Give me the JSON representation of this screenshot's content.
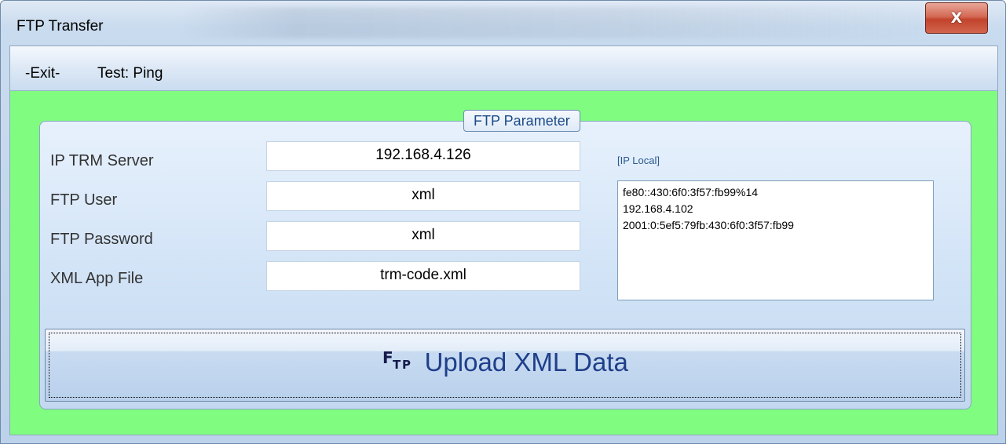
{
  "window": {
    "title": "FTP Transfer",
    "close_glyph": "X"
  },
  "menu": {
    "items": [
      {
        "label": "-Exit-"
      },
      {
        "label": "Test: Ping"
      }
    ]
  },
  "group": {
    "legend": "FTP Parameter",
    "fields": [
      {
        "label": "IP TRM Server",
        "value": "192.168.4.126"
      },
      {
        "label": "FTP User",
        "value": "xml"
      },
      {
        "label": "FTP Password",
        "value": "xml"
      },
      {
        "label": "XML App File",
        "value": "trm-code.xml"
      }
    ],
    "ip_local": {
      "label": "[IP Local]",
      "addresses": [
        "fe80::430:6f0:3f57:fb99%14",
        "192.168.4.102",
        "2001:0:5ef5:79fb:430:6f0:3f57:fb99"
      ]
    }
  },
  "upload_button": {
    "label": "Upload XML Data",
    "icon": "ftp-icon"
  },
  "colors": {
    "client_background": "#80fc80",
    "button_text": "#1f3f8a",
    "legend_text": "#1b4a86",
    "close_button": "#c2432c"
  }
}
